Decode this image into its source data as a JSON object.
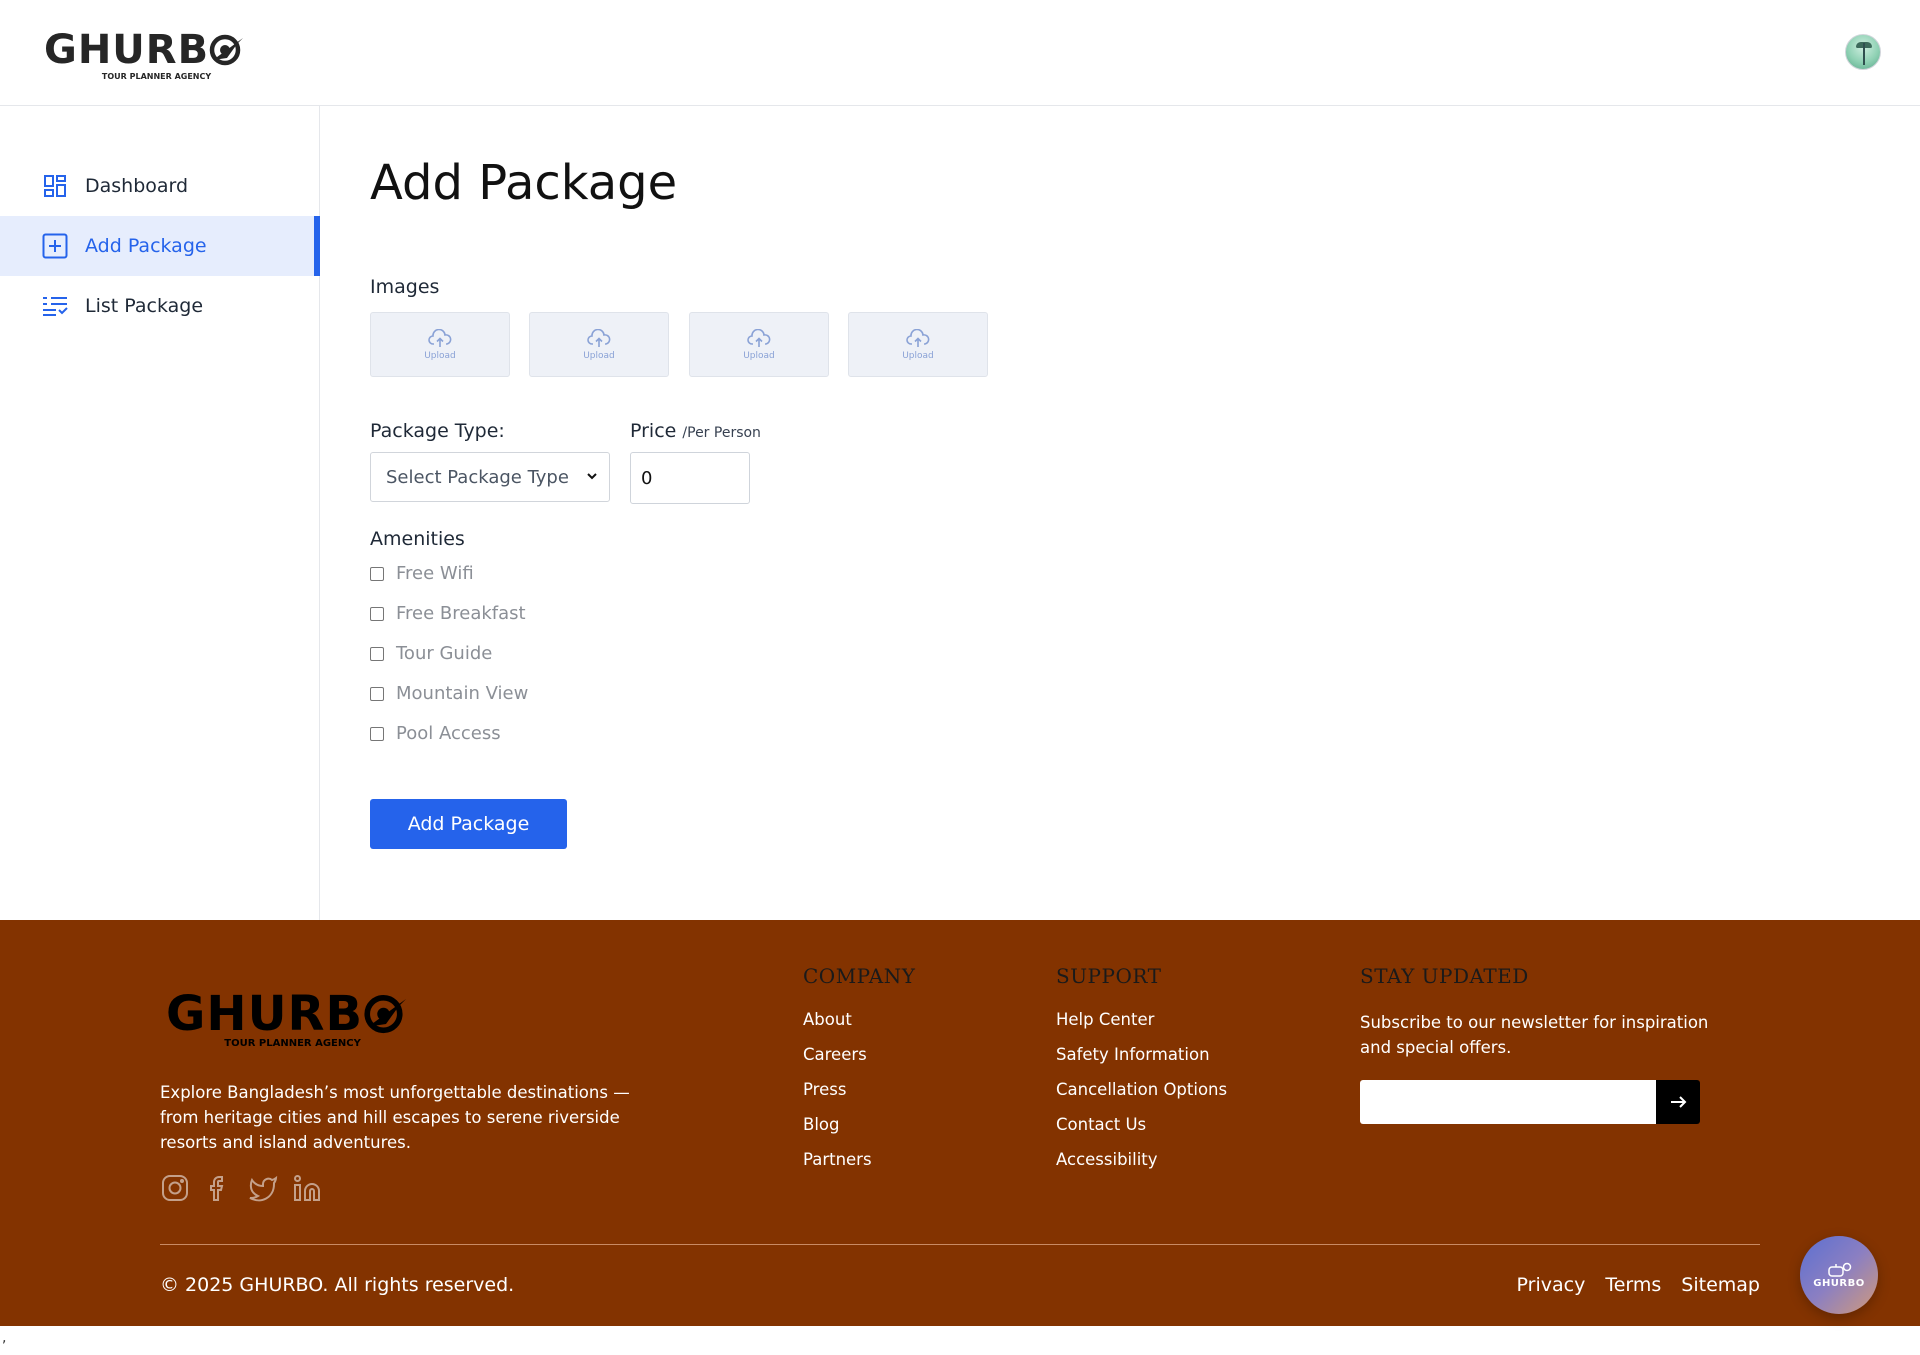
{
  "header": {
    "logo_word": "GHURB",
    "logo_tagline": "TOUR PLANNER AGENCY"
  },
  "sidebar": {
    "items": [
      {
        "label": "Dashboard",
        "icon": "dashboard-icon"
      },
      {
        "label": "Add Package",
        "icon": "plus-square-icon",
        "active": true
      },
      {
        "label": "List Package",
        "icon": "list-check-icon"
      }
    ]
  },
  "main": {
    "title": "Add Package",
    "images_label": "Images",
    "upload_label": "Upload",
    "package_type_label": "Package Type:",
    "package_type_selected": "Select Package Type",
    "price_label": "Price",
    "price_unit": "/Per Person",
    "price_value": "0",
    "amenities_label": "Amenities",
    "amenities": [
      "Free Wifi",
      "Free Breakfast",
      "Tour Guide",
      "Mountain View",
      "Pool Access"
    ],
    "submit_label": "Add Package"
  },
  "footer": {
    "logo_word": "GHURB",
    "logo_tagline": "TOUR PLANNER AGENCY",
    "description": "Explore Bangladesh’s most unforgettable destinations — from heritage cities and hill escapes to serene riverside resorts and island adventures.",
    "company_heading": "COMPANY",
    "company_links": [
      "About",
      "Careers",
      "Press",
      "Blog",
      "Partners"
    ],
    "support_heading": "SUPPORT",
    "support_links": [
      "Help Center",
      "Safety Information",
      "Cancellation Options",
      "Contact Us",
      "Accessibility"
    ],
    "newsletter_heading": "STAY UPDATED",
    "newsletter_text": "Subscribe to our newsletter for inspiration and special offers.",
    "copyright": "© 2025 GHURBO. All rights reserved.",
    "legal_links": [
      "Privacy",
      "Terms",
      "Sitemap"
    ]
  },
  "fab_label": "GHURBO",
  "stray_char": ",",
  "colors": {
    "accent": "#2563eb",
    "footer_bg": "#833300",
    "active_bg": "#e6edfd"
  }
}
